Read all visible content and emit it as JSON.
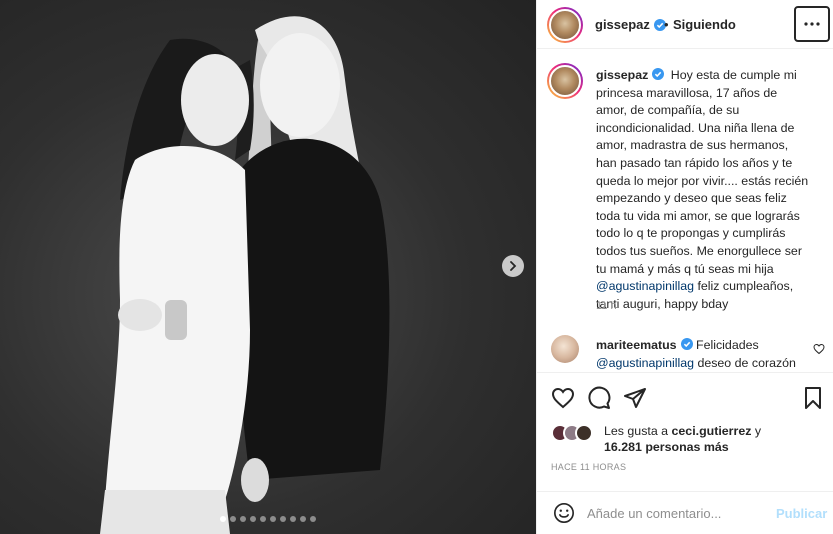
{
  "post": {
    "username": "gissepaz",
    "follow_status": "Siguiendo",
    "separator": "•",
    "caption_lines": [
      "Hoy esta de cumple mi",
      "princesa maravillosa, 17 años de",
      "amor, de compañía, de su",
      "incondicionalidad. Una niña llena de",
      "amor, madrastra de sus hermanos,",
      "han pasado tan rápido los años y te",
      "queda lo mejor por vivir.... estás recién",
      "empezando y deseo que seas feliz",
      "toda tu vida mi amor, se que lograrás",
      "todo lo q te propongas y cumplirás",
      "todos tus sueños. Me enorgullece ser",
      "tu mamá y más q tú seas mi hija"
    ],
    "caption_mention": "@agustinapinillag",
    "caption_tail": " feliz cumpleaños,",
    "caption_last": "tanti auguri, happy bday",
    "caption_time": "11 h"
  },
  "comment": {
    "username": "mariteematus",
    "text_start": " Felicidades",
    "mention": "@agustinapinillag",
    "text_end": " deseo de corazón"
  },
  "likes": {
    "prefix": "Les gusta a ",
    "first_liker": "ceci.gutierrez",
    "conjunction": " y",
    "others": "16.281 personas más"
  },
  "timestamp": "HACE 11 HORAS",
  "add_comment": {
    "placeholder": "Añade un comentario...",
    "publish_label": "Publicar"
  },
  "carousel": {
    "total": 10,
    "active": 0
  },
  "colors": {
    "accent_link": "#00376b",
    "verified": "#3897f0",
    "publish": "#b2dffc"
  },
  "icons": [
    "chevron-right-icon",
    "verified-icon",
    "more-options-icon",
    "heart-icon",
    "comment-icon",
    "share-icon",
    "bookmark-icon",
    "emoji-icon"
  ]
}
